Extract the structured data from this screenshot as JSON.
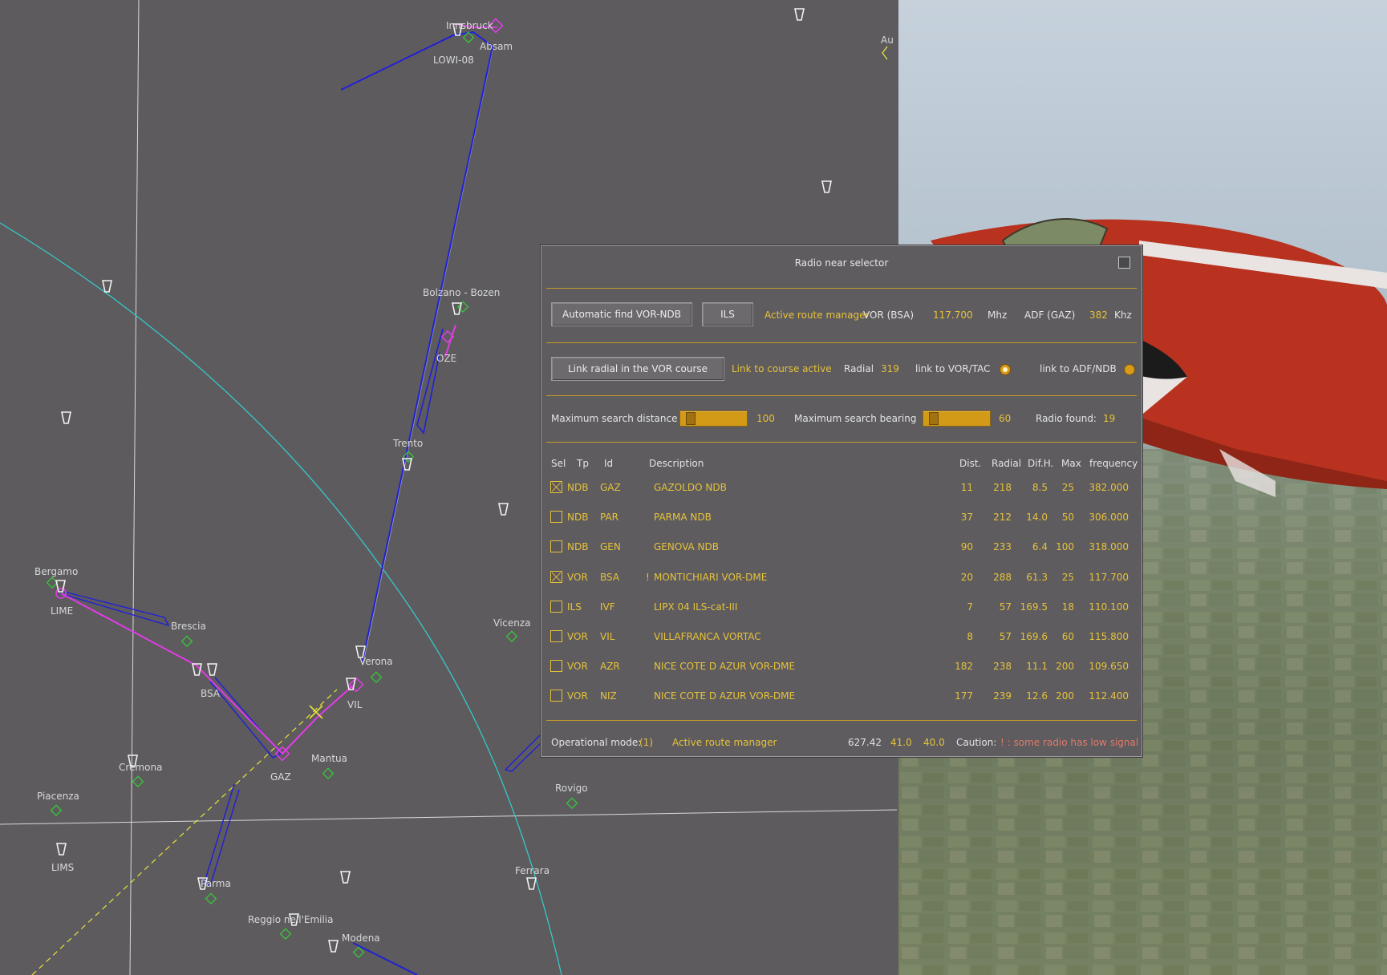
{
  "map": {
    "labels": [
      {
        "id": "innsbruck",
        "text": "Innsbruck"
      },
      {
        "id": "absam",
        "text": "Absam"
      },
      {
        "id": "lowi",
        "text": "LOWI-08"
      },
      {
        "id": "au",
        "text": "Au"
      },
      {
        "id": "bolzano",
        "text": "Bolzano - Bozen"
      },
      {
        "id": "oze",
        "text": "OZE"
      },
      {
        "id": "trento",
        "text": "Trento"
      },
      {
        "id": "bergamo",
        "text": "Bergamo"
      },
      {
        "id": "lime",
        "text": "LIME"
      },
      {
        "id": "brescia",
        "text": "Brescia"
      },
      {
        "id": "bsa",
        "text": "BSA"
      },
      {
        "id": "vicenza",
        "text": "Vicenza"
      },
      {
        "id": "verona",
        "text": "Verona"
      },
      {
        "id": "vil",
        "text": "VIL"
      },
      {
        "id": "mantua",
        "text": "Mantua"
      },
      {
        "id": "gaz",
        "text": "GAZ"
      },
      {
        "id": "cremona",
        "text": "Cremona"
      },
      {
        "id": "piacenza",
        "text": "Piacenza"
      },
      {
        "id": "rovigo",
        "text": "Rovigo"
      },
      {
        "id": "lims",
        "text": "LIMS"
      },
      {
        "id": "parma",
        "text": "Parma"
      },
      {
        "id": "ferrara",
        "text": "Ferrara"
      },
      {
        "id": "reggio",
        "text": "Reggio nell'Emilia"
      },
      {
        "id": "modena",
        "text": "Modena"
      }
    ]
  },
  "dialog": {
    "title": "Radio near selector",
    "row1": {
      "auto_find_button": "Automatic find VOR-NDB",
      "ils_button": "ILS",
      "active_route": "Active route manager",
      "vor_label": "VOR (BSA)",
      "vor_freq": "117.700",
      "mhz": "Mhz",
      "adf_label": "ADF (GAZ)",
      "adf_freq": "382",
      "khz": "Khz"
    },
    "row2": {
      "link_radial_button": "Link radial in the VOR course",
      "link_course_active": "Link to course active",
      "radial_label": "Radial",
      "radial_value": "319",
      "link_vor_label": "link to VOR/TAC",
      "link_vor_selected": true,
      "link_adf_label": "link to ADF/NDB",
      "link_adf_selected": false
    },
    "row3": {
      "max_dist_label": "Maximum search distance",
      "max_dist_value": "100",
      "max_dist_level": 0.1,
      "max_bearing_label": "Maximum search bearing",
      "max_bearing_value": "60",
      "max_bearing_level": 0.1,
      "radio_found_label": "Radio found:",
      "radio_found_value": "19"
    },
    "table": {
      "headers": {
        "sel": "Sel",
        "tp": "Tp",
        "id": "Id",
        "desc": "Description",
        "dist": "Dist.",
        "radial": "Radial",
        "difh": "Dif.H.",
        "max": "Max",
        "freq": "frequency"
      },
      "rows": [
        {
          "sel": true,
          "tp": "NDB",
          "id": "GAZ",
          "flag": "",
          "desc": "GAZOLDO NDB",
          "dist": "11",
          "radial": "218",
          "difh": "8.5",
          "max": "25",
          "freq": "382.000"
        },
        {
          "sel": false,
          "tp": "NDB",
          "id": "PAR",
          "flag": "",
          "desc": "PARMA NDB",
          "dist": "37",
          "radial": "212",
          "difh": "14.0",
          "max": "50",
          "freq": "306.000"
        },
        {
          "sel": false,
          "tp": "NDB",
          "id": "GEN",
          "flag": "",
          "desc": "GENOVA NDB",
          "dist": "90",
          "radial": "233",
          "difh": "6.4",
          "max": "100",
          "freq": "318.000"
        },
        {
          "sel": true,
          "tp": "VOR",
          "id": "BSA",
          "flag": "!",
          "desc": "MONTICHIARI VOR-DME",
          "dist": "20",
          "radial": "288",
          "difh": "61.3",
          "max": "25",
          "freq": "117.700"
        },
        {
          "sel": false,
          "tp": "ILS",
          "id": "IVF",
          "flag": "",
          "desc": "LIPX 04 ILS-cat-III",
          "dist": "7",
          "radial": "57",
          "difh": "169.5",
          "max": "18",
          "freq": "110.100"
        },
        {
          "sel": false,
          "tp": "VOR",
          "id": "VIL",
          "flag": "",
          "desc": "VILLAFRANCA VORTAC",
          "dist": "8",
          "radial": "57",
          "difh": "169.6",
          "max": "60",
          "freq": "115.800"
        },
        {
          "sel": false,
          "tp": "VOR",
          "id": "AZR",
          "flag": "",
          "desc": "NICE COTE D AZUR VOR-DME",
          "dist": "182",
          "radial": "238",
          "difh": "11.1",
          "max": "200",
          "freq": "109.650"
        },
        {
          "sel": false,
          "tp": "VOR",
          "id": "NIZ",
          "flag": "",
          "desc": "NICE COTE D AZUR VOR-DME",
          "dist": "177",
          "radial": "239",
          "difh": "12.6",
          "max": "200",
          "freq": "112.400"
        }
      ]
    },
    "footer": {
      "op_mode_label": "Operational mode:",
      "op_mode_value": "(1)",
      "op_mode_name": "Active route manager",
      "v1": "627.42",
      "v2": "41.0",
      "v3": "40.0",
      "caution_label": "Caution:",
      "caution_text": "! : some radio has low signal"
    }
  },
  "colors": {
    "accent": "#e6c23a",
    "separator": "#c69a2a",
    "route": "#1a1ad0",
    "magenta": "#e23ce6",
    "cyan": "#35c8c8",
    "waypoint": "#39c639"
  }
}
